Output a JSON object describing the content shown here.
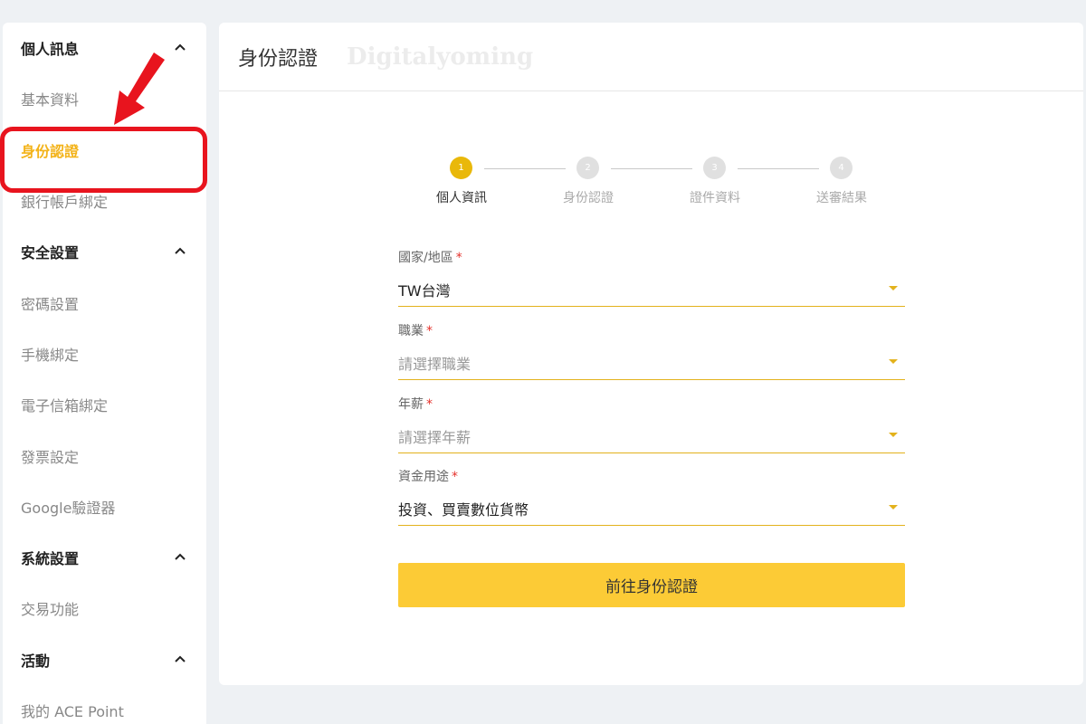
{
  "sidebar": {
    "sections": [
      {
        "title": "個人訊息",
        "items": [
          "基本資料",
          "身份認證",
          "銀行帳戶綁定"
        ]
      },
      {
        "title": "安全設置",
        "items": [
          "密碼設置",
          "手機綁定",
          "電子信箱綁定",
          "發票設定",
          "Google驗證器"
        ]
      },
      {
        "title": "系統設置",
        "items": [
          "交易功能"
        ]
      },
      {
        "title": "活動",
        "items": [
          "我的 ACE Point"
        ]
      }
    ],
    "active_item": "身份認證"
  },
  "main": {
    "title": "身份認證",
    "watermark": "Digitalyoming",
    "steps": [
      {
        "number": "1",
        "label": "個人資訊"
      },
      {
        "number": "2",
        "label": "身份認證"
      },
      {
        "number": "3",
        "label": "證件資料"
      },
      {
        "number": "4",
        "label": "送審結果"
      }
    ],
    "current_step": 1,
    "form": {
      "country": {
        "label": "國家/地區",
        "value": "TW台灣"
      },
      "occupation": {
        "label": "職業",
        "placeholder": "請選擇職業"
      },
      "salary": {
        "label": "年薪",
        "placeholder": "請選擇年薪"
      },
      "purpose": {
        "label": "資金用途",
        "value": "投資、買賣數位貨幣"
      },
      "required_mark": "*",
      "submit_label": "前往身份認證"
    }
  },
  "colors": {
    "accent": "#fccb36",
    "step_active": "#e9b80a",
    "active_text": "#f3b319",
    "annotation": "#e8141e"
  }
}
